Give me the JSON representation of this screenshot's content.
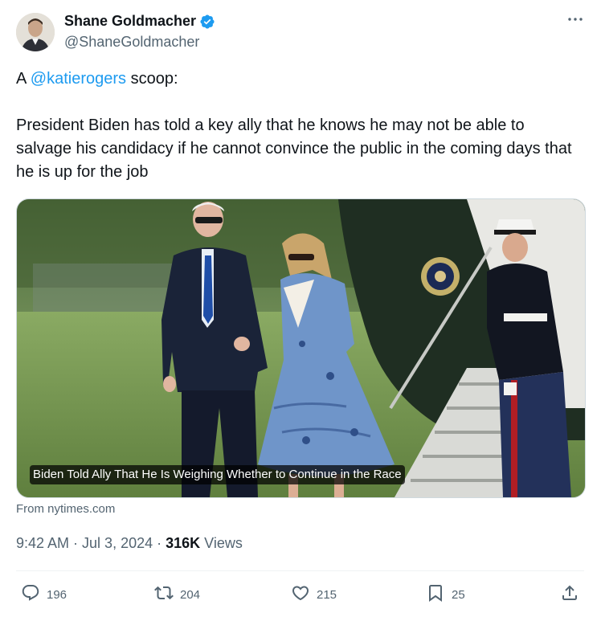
{
  "author": {
    "display_name": "Shane Goldmacher",
    "handle": "@ShaneGoldmacher",
    "verified_icon": "verified-badge-icon",
    "verified_color": "#1d9bf0"
  },
  "tweet": {
    "text_prefix": "A ",
    "mention": "@katierogers",
    "text_suffix": " scoop:",
    "body": "President Biden has told a key ally that he knows he may not be able to salvage his candidacy if he cannot convince the public in the coming days that he is up for the job"
  },
  "card": {
    "headline": "Biden Told Ally That He Is Weighing Whether to Continue in the Race",
    "source": "From nytimes.com"
  },
  "meta": {
    "time": "9:42 AM",
    "sep1": " · ",
    "date": "Jul 3, 2024",
    "sep2": " · ",
    "views_count": "316K",
    "views_label": " Views"
  },
  "actions": {
    "replies": "196",
    "reposts": "204",
    "likes": "215",
    "bookmarks": "25"
  },
  "colors": {
    "text": "#0f1419",
    "secondary": "#536471",
    "link": "#1d9bf0"
  }
}
